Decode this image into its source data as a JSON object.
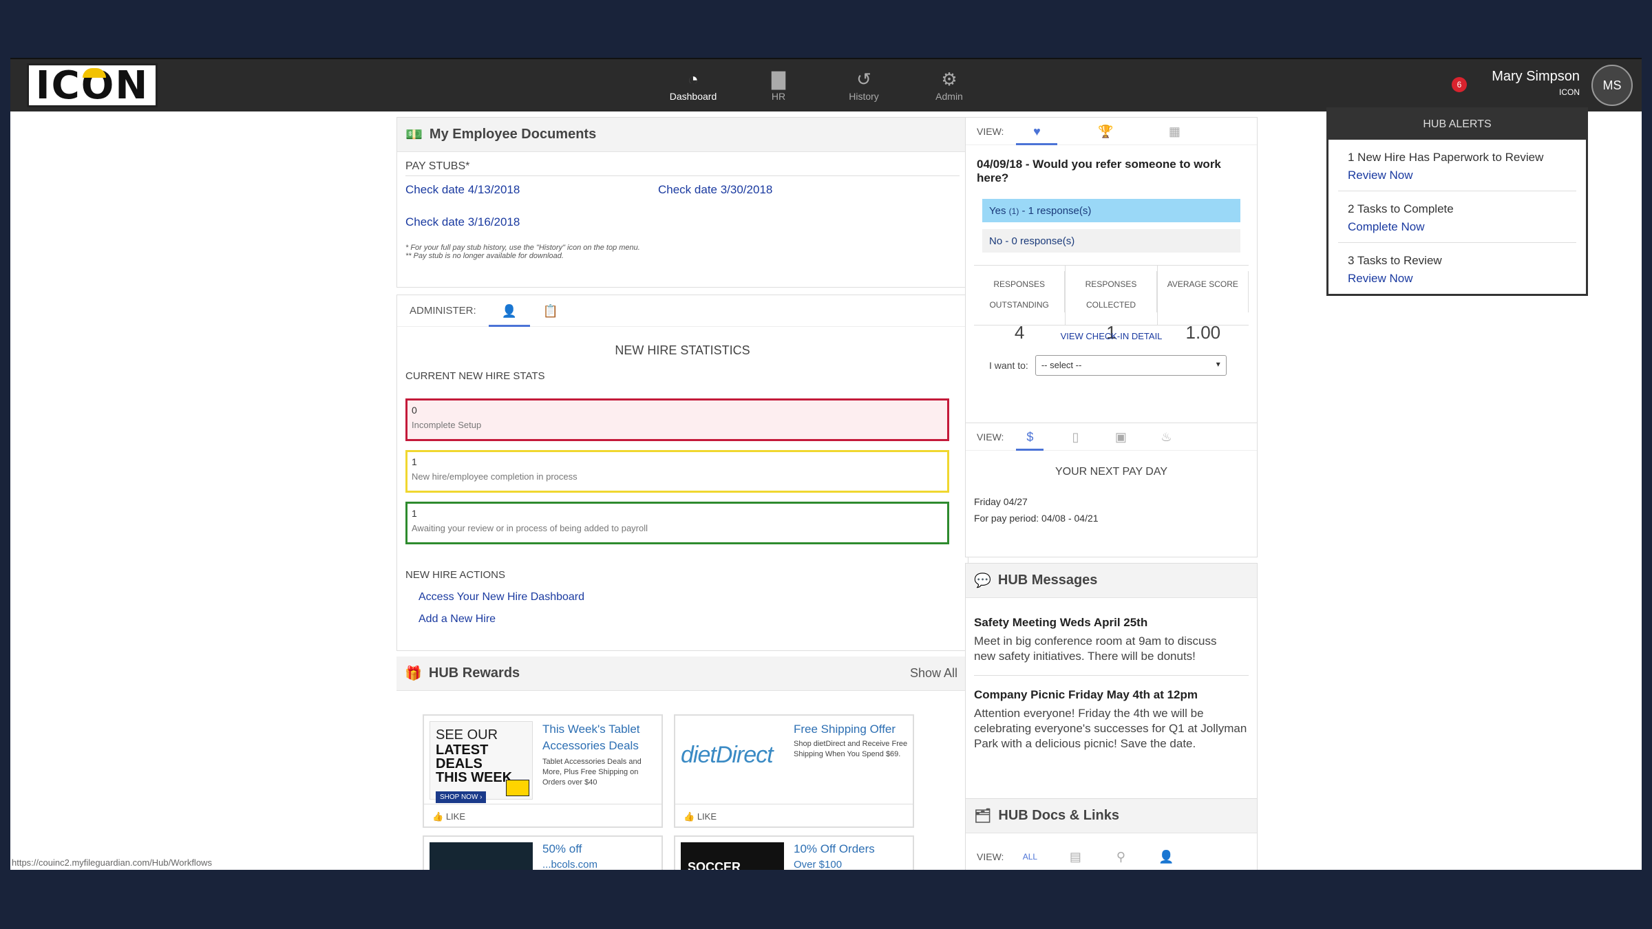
{
  "brand": {
    "logo": "ICON"
  },
  "nav": [
    {
      "label": "Dashboard",
      "icon": "dashboard-icon",
      "glyph": "◔",
      "active": true
    },
    {
      "label": "HR",
      "icon": "folder-icon",
      "glyph": "▇",
      "active": false
    },
    {
      "label": "History",
      "icon": "history-icon",
      "glyph": "↺",
      "active": false
    },
    {
      "label": "Admin",
      "icon": "gear-icon",
      "glyph": "⚙",
      "active": false
    }
  ],
  "alerts_count": "6",
  "user": {
    "name": "Mary Simpson",
    "company": "ICON",
    "initials": "MS"
  },
  "documents": {
    "title": "My Employee Documents",
    "paystubs_label": "PAY STUBS*",
    "checks": [
      "Check date 4/13/2018",
      "Check date 3/30/2018",
      "Check date 3/16/2018"
    ],
    "note1": "* For your full pay stub history, use the \"History\" icon on the top menu.",
    "note2": "** Pay stub is no longer available for download."
  },
  "administer": {
    "label": "ADMINISTER:",
    "title": "NEW HIRE STATISTICS",
    "current_label": "CURRENT NEW HIRE STATS",
    "stats": [
      {
        "value": "0",
        "desc": "Incomplete Setup",
        "color": "#c41a3a",
        "bg": "#fdeef0"
      },
      {
        "value": "1",
        "desc": "New hire/employee completion in process",
        "color": "#f0d730",
        "bg": "#ffffff"
      },
      {
        "value": "1",
        "desc": "Awaiting your review or in process of being added to payroll",
        "color": "#2e8b2e",
        "bg": "#ffffff"
      }
    ],
    "actions_label": "NEW HIRE ACTIONS",
    "actions": [
      "Access Your New Hire Dashboard",
      "Add a New Hire"
    ]
  },
  "rewards": {
    "title": "HUB Rewards",
    "show_all": "Show All",
    "items": [
      {
        "title": "This Week's Tablet Accessories Deals",
        "desc": "Tablet Accessories Deals and More, Plus Free Shipping on Orders over $40",
        "img_l1": "SEE OUR",
        "img_l2": "LATEST DEALS",
        "img_l3": "THIS WEEK",
        "img_btn": "SHOP NOW ›",
        "like": "LIKE"
      },
      {
        "title": "Free Shipping Offer",
        "desc": "Shop dietDirect and Receive Free Shipping When You Spend $69.",
        "img_l1": "dietDirect",
        "like": "LIKE"
      },
      {
        "title": "50% off",
        "subtitle": "...bcols.com"
      },
      {
        "title": "10% Off Orders",
        "subtitle": "Over $100",
        "img_l1": "SOCCER GEAR"
      }
    ]
  },
  "survey": {
    "view_label": "VIEW:",
    "question": "04/09/18 - Would you refer someone to work here?",
    "yes": "Yes",
    "yes_count": "(1)",
    "yes_resp": " - 1 response(s)",
    "no": "No - 0 response(s)",
    "stats": [
      {
        "label1": "RESPONSES",
        "label2": "OUTSTANDING",
        "value": "4"
      },
      {
        "label1": "RESPONSES",
        "label2": "COLLECTED",
        "value": "1"
      },
      {
        "label1": "AVERAGE SCORE",
        "label2": "",
        "value": "1.00"
      }
    ],
    "detail_link": "VIEW CHECK-IN DETAIL",
    "want_label": "I want to:",
    "select_value": "-- select --"
  },
  "payday": {
    "view_label": "VIEW:",
    "title": "YOUR NEXT PAY DAY",
    "date": "Friday 04/27",
    "period": "For pay period: 04/08 - 04/21"
  },
  "messages": {
    "title": "HUB Messages",
    "items": [
      {
        "title": "Safety Meeting Weds April 25th",
        "body": "Meet in big conference room at 9am to discuss new safety initiatives. There will be donuts!"
      },
      {
        "title": "Company Picnic Friday May 4th at 12pm",
        "body": "Attention everyone! Friday the 4th we will be celebrating everyone's successes for Q1 at Jollyman Park with a delicious picnic! Save the date."
      }
    ]
  },
  "docs": {
    "title": "HUB Docs & Links",
    "view_label": "VIEW:",
    "all": "ALL"
  },
  "hub_alerts": {
    "title": "HUB ALERTS",
    "items": [
      {
        "text": "1 New Hire Has Paperwork to Review",
        "action": "Review Now"
      },
      {
        "text": "2 Tasks to Complete",
        "action": "Complete Now"
      },
      {
        "text": "3 Tasks to Review",
        "action": "Review Now"
      }
    ]
  },
  "status_url": "https://couinc2.myfileguardian.com/Hub/Workflows"
}
